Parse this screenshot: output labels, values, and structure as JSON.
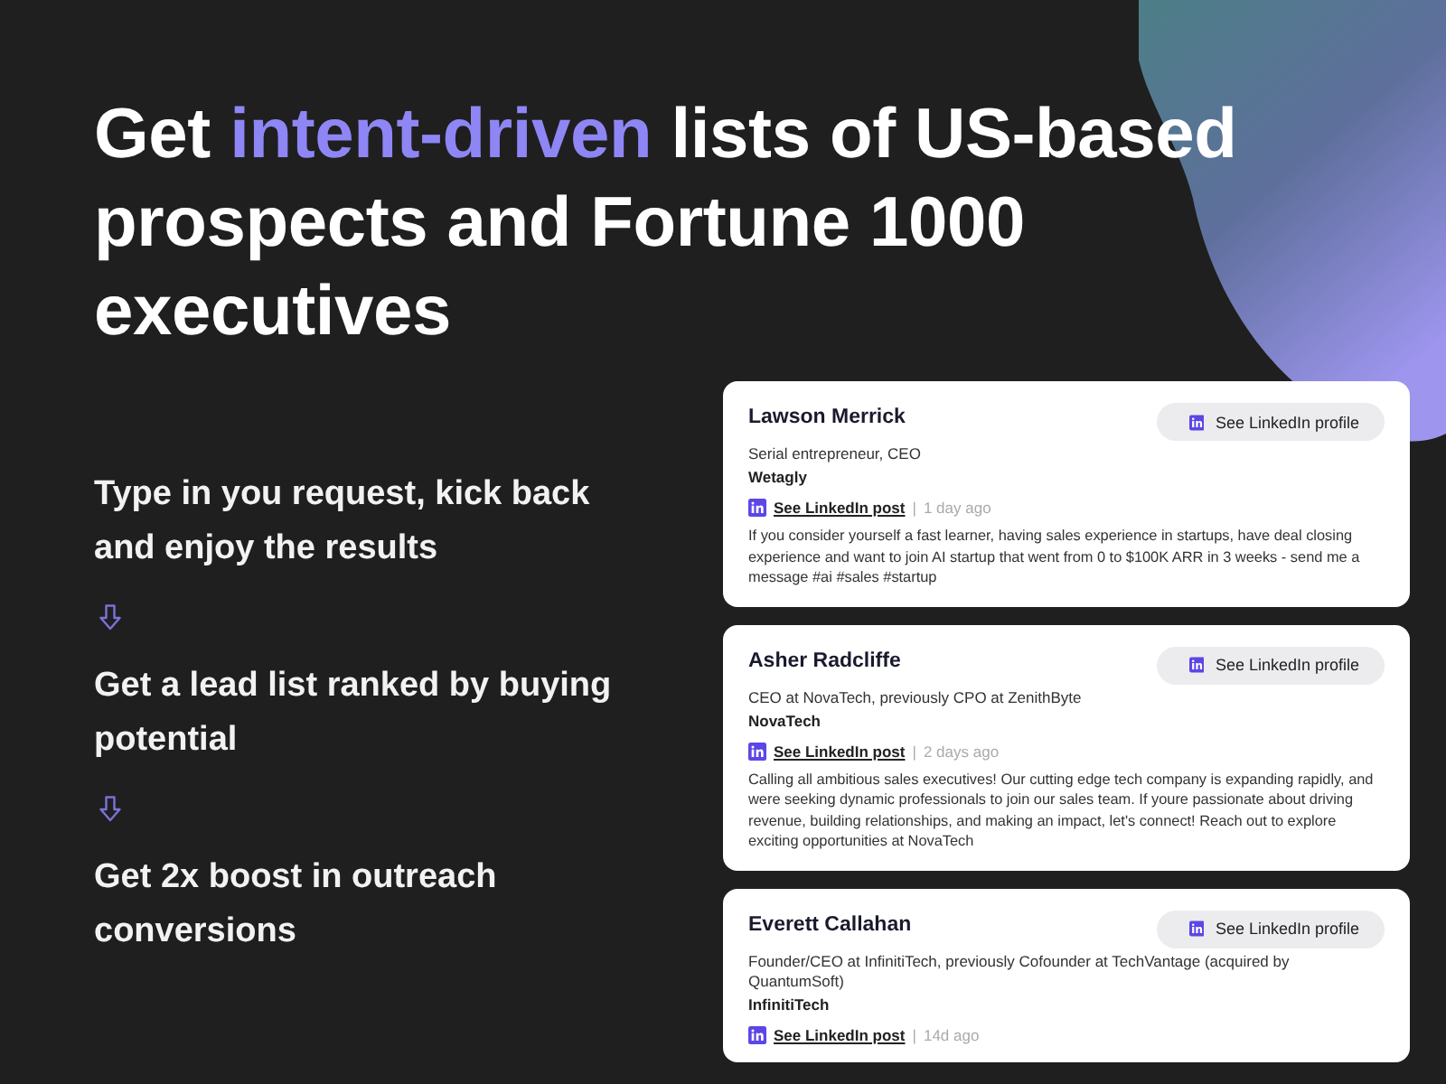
{
  "headline": [
    {
      "kind": "plain",
      "text": "Get "
    },
    {
      "kind": "highlight",
      "text": "intent-driven"
    },
    {
      "kind": "plain",
      "text": " lists of US-based prospects and Fortune 1000 executives"
    }
  ],
  "steps": [
    {
      "text": "Type in you request, kick back and enjoy the results"
    },
    {
      "text": "Get a lead list ranked by buying potential"
    },
    {
      "text": "Get 2x boost in outreach conversions"
    }
  ],
  "cards": [
    {
      "name": "Lawson Merrick",
      "role": "Serial entrepreneur, CEO",
      "company": "Wetagly",
      "profile_button": "See LinkedIn profile",
      "post_link": "See LinkedIn post",
      "separator": "|",
      "time": "1 day ago",
      "post": "If you consider yourself a fast learner, having sales experience in startups, have deal closing experience and want to join AI startup that went from 0 to $100K ARR in 3 weeks - send me a message #ai #sales #startup"
    },
    {
      "name": "Asher Radcliffe",
      "role": "CEO at NovaTech, previously CPO at ZenithByte",
      "company": "NovaTech",
      "profile_button": "See LinkedIn profile",
      "post_link": "See LinkedIn post",
      "separator": "|",
      "time": "2 days ago",
      "post": "Calling all ambitious sales executives! Our cutting edge tech company is expanding rapidly, and were seeking dynamic professionals to join our sales team. If youre passionate about driving revenue, building relationships, and making an impact, let's connect! Reach out to explore exciting opportunities at NovaTech"
    },
    {
      "name": "Everett Callahan",
      "role": "Founder/CEO at InfinitiTech, previously Cofounder at TechVantage (acquired by QuantumSoft)",
      "company": "InfinitiTech",
      "profile_button": "See LinkedIn profile",
      "post_link": "See LinkedIn post",
      "separator": "|",
      "time": "14d ago"
    }
  ]
}
